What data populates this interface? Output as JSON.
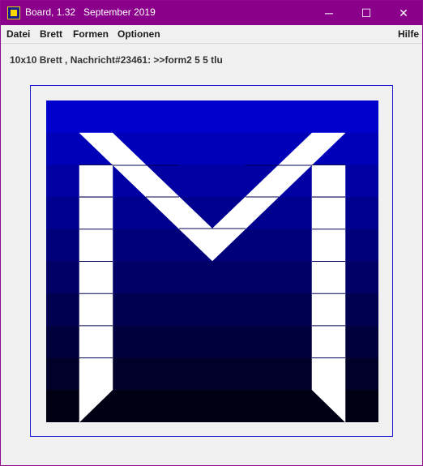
{
  "window": {
    "title": "Board, 1.32   September 2019",
    "controls": {
      "minimize": "─",
      "maximize": "☐",
      "close": "✕"
    },
    "icon": "board-app-icon",
    "title_bar_color": "#8b008b"
  },
  "menubar": {
    "datei": "Datei",
    "brett": "Brett",
    "formen": "Formen",
    "optionen": "Optionen",
    "hilfe": "Hilfe"
  },
  "status": {
    "text": "10x10 Brett , Nachricht#23461: >>form2 5 5 tlu"
  },
  "board": {
    "rows": 10,
    "cols": 10,
    "gradient_top": "#0000cc",
    "gradient_bottom": "#000014",
    "shape_color": "#ffffff",
    "frame_color": "#1c1cd0"
  }
}
